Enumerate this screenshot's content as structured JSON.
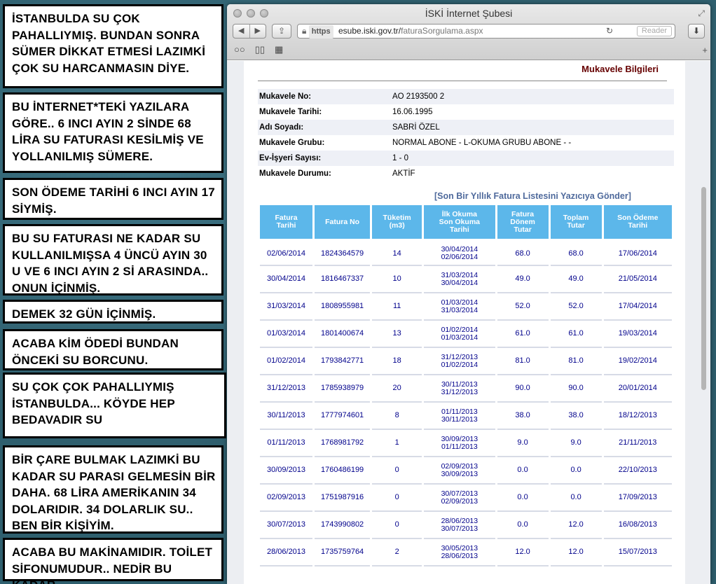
{
  "notes": [
    "İSTANBULDA SU ÇOK PAHALLIYMIŞ. BUNDAN SONRA SÜMER DİKKAT ETMESİ LAZIMKİ ÇOK SU HARCANMASIN DİYE.",
    "BU İNTERNET*TEKİ YAZILARA GÖRE.. 6 INCI AYIN 2 SİNDE 68 LİRA SU FATURASI KESİLMİŞ VE YOLLANILMIŞ SÜMERE.",
    "SON ÖDEME TARİHİ 6 INCI AYIN 17 SİYMİŞ.",
    "BU SU FATURASI NE KADAR SU KULLANILMIŞSA 4 ÜNCÜ AYIN 30 U VE 6 INCI AYIN 2 Sİ ARASINDA.. ONUN İÇİNMİŞ.",
    "DEMEK 32 GÜN İÇİNMİŞ.",
    "ACABA KİM ÖDEDİ BUNDAN ÖNCEKİ SU BORCUNU.",
    "SU ÇOK ÇOK PAHALLIYMIŞ İSTANBULDA... KÖYDE HEP BEDAVADIR SU",
    "BİR ÇARE BULMAK LAZIMKİ BU KADAR SU PARASI GELMESİN BİR DAHA. 68 LİRA AMERİKANIN 34 DOLARIDIR. 34 DOLARLIK SU.. BEN BİR KİŞİYİM.",
    "ACABA BU MAKİNAMIDIR. TOİLET SİFONUMUDUR.. NEDİR BU KADAR"
  ],
  "browser": {
    "window_title": "İSKİ İnternet Şubesi",
    "url_scheme": "https",
    "url_host": "esube.iski.gov.tr/",
    "url_path": "faturaSorgulama.aspx",
    "reader_label": "Reader"
  },
  "page": {
    "section_title": "Mukavele Bilgileri",
    "info": [
      {
        "k": "Mukavele No:",
        "v": "AO 2193500 2"
      },
      {
        "k": "Mukavele Tarihi:",
        "v": "16.06.1995"
      },
      {
        "k": "Adı Soyadı:",
        "v": "SABRİ ÖZEL"
      },
      {
        "k": "Mukavele Grubu:",
        "v": "NORMAL ABONE - L-OKUMA GRUBU ABONE - -"
      },
      {
        "k": "Ev-İşyeri Sayısı:",
        "v": "1 - 0"
      },
      {
        "k": "Mukavele Durumu:",
        "v": "AKTİF"
      }
    ],
    "print_link": "[Son Bir Yıllık Fatura Listesini Yazıcıya Gönder]",
    "columns": [
      "Fatura Tarihi",
      "Fatura No",
      "Tüketim (m3)",
      "İlk Okuma Son Okuma Tarihi",
      "Fatura Dönem Tutar",
      "Toplam Tutar",
      "Son Ödeme Tarihi"
    ],
    "rows": [
      {
        "date": "02/06/2014",
        "no": "1824364579",
        "cons": "14",
        "r1": "30/04/2014",
        "r2": "02/06/2014",
        "period": "68.0",
        "total": "68.0",
        "due": "17/06/2014"
      },
      {
        "date": "30/04/2014",
        "no": "1816467337",
        "cons": "10",
        "r1": "31/03/2014",
        "r2": "30/04/2014",
        "period": "49.0",
        "total": "49.0",
        "due": "21/05/2014"
      },
      {
        "date": "31/03/2014",
        "no": "1808955981",
        "cons": "11",
        "r1": "01/03/2014",
        "r2": "31/03/2014",
        "period": "52.0",
        "total": "52.0",
        "due": "17/04/2014"
      },
      {
        "date": "01/03/2014",
        "no": "1801400674",
        "cons": "13",
        "r1": "01/02/2014",
        "r2": "01/03/2014",
        "period": "61.0",
        "total": "61.0",
        "due": "19/03/2014"
      },
      {
        "date": "01/02/2014",
        "no": "1793842771",
        "cons": "18",
        "r1": "31/12/2013",
        "r2": "01/02/2014",
        "period": "81.0",
        "total": "81.0",
        "due": "19/02/2014"
      },
      {
        "date": "31/12/2013",
        "no": "1785938979",
        "cons": "20",
        "r1": "30/11/2013",
        "r2": "31/12/2013",
        "period": "90.0",
        "total": "90.0",
        "due": "20/01/2014"
      },
      {
        "date": "30/11/2013",
        "no": "1777974601",
        "cons": "8",
        "r1": "01/11/2013",
        "r2": "30/11/2013",
        "period": "38.0",
        "total": "38.0",
        "due": "18/12/2013"
      },
      {
        "date": "01/11/2013",
        "no": "1768981792",
        "cons": "1",
        "r1": "30/09/2013",
        "r2": "01/11/2013",
        "period": "9.0",
        "total": "9.0",
        "due": "21/11/2013"
      },
      {
        "date": "30/09/2013",
        "no": "1760486199",
        "cons": "0",
        "r1": "02/09/2013",
        "r2": "30/09/2013",
        "period": "0.0",
        "total": "0.0",
        "due": "22/10/2013"
      },
      {
        "date": "02/09/2013",
        "no": "1751987916",
        "cons": "0",
        "r1": "30/07/2013",
        "r2": "02/09/2013",
        "period": "0.0",
        "total": "0.0",
        "due": "17/09/2013"
      },
      {
        "date": "30/07/2013",
        "no": "1743990802",
        "cons": "0",
        "r1": "28/06/2013",
        "r2": "30/07/2013",
        "period": "0.0",
        "total": "12.0",
        "due": "16/08/2013"
      },
      {
        "date": "28/06/2013",
        "no": "1735759764",
        "cons": "2",
        "r1": "30/05/2013",
        "r2": "28/06/2013",
        "period": "12.0",
        "total": "12.0",
        "due": "15/07/2013"
      }
    ]
  }
}
